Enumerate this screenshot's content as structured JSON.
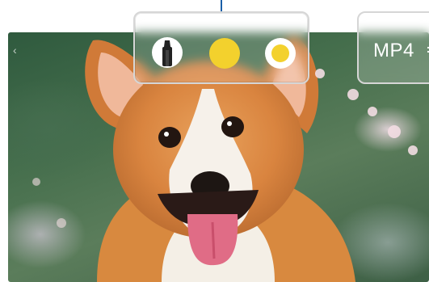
{
  "toolbar": {
    "pen_icon": "pen-icon",
    "color_icon": "color-circle-icon",
    "outline_icon": "ring-icon",
    "accent_color": "#f3d12d"
  },
  "format": {
    "label": "MP4"
  },
  "nav": {
    "back_icon": "chevron-left-icon"
  }
}
